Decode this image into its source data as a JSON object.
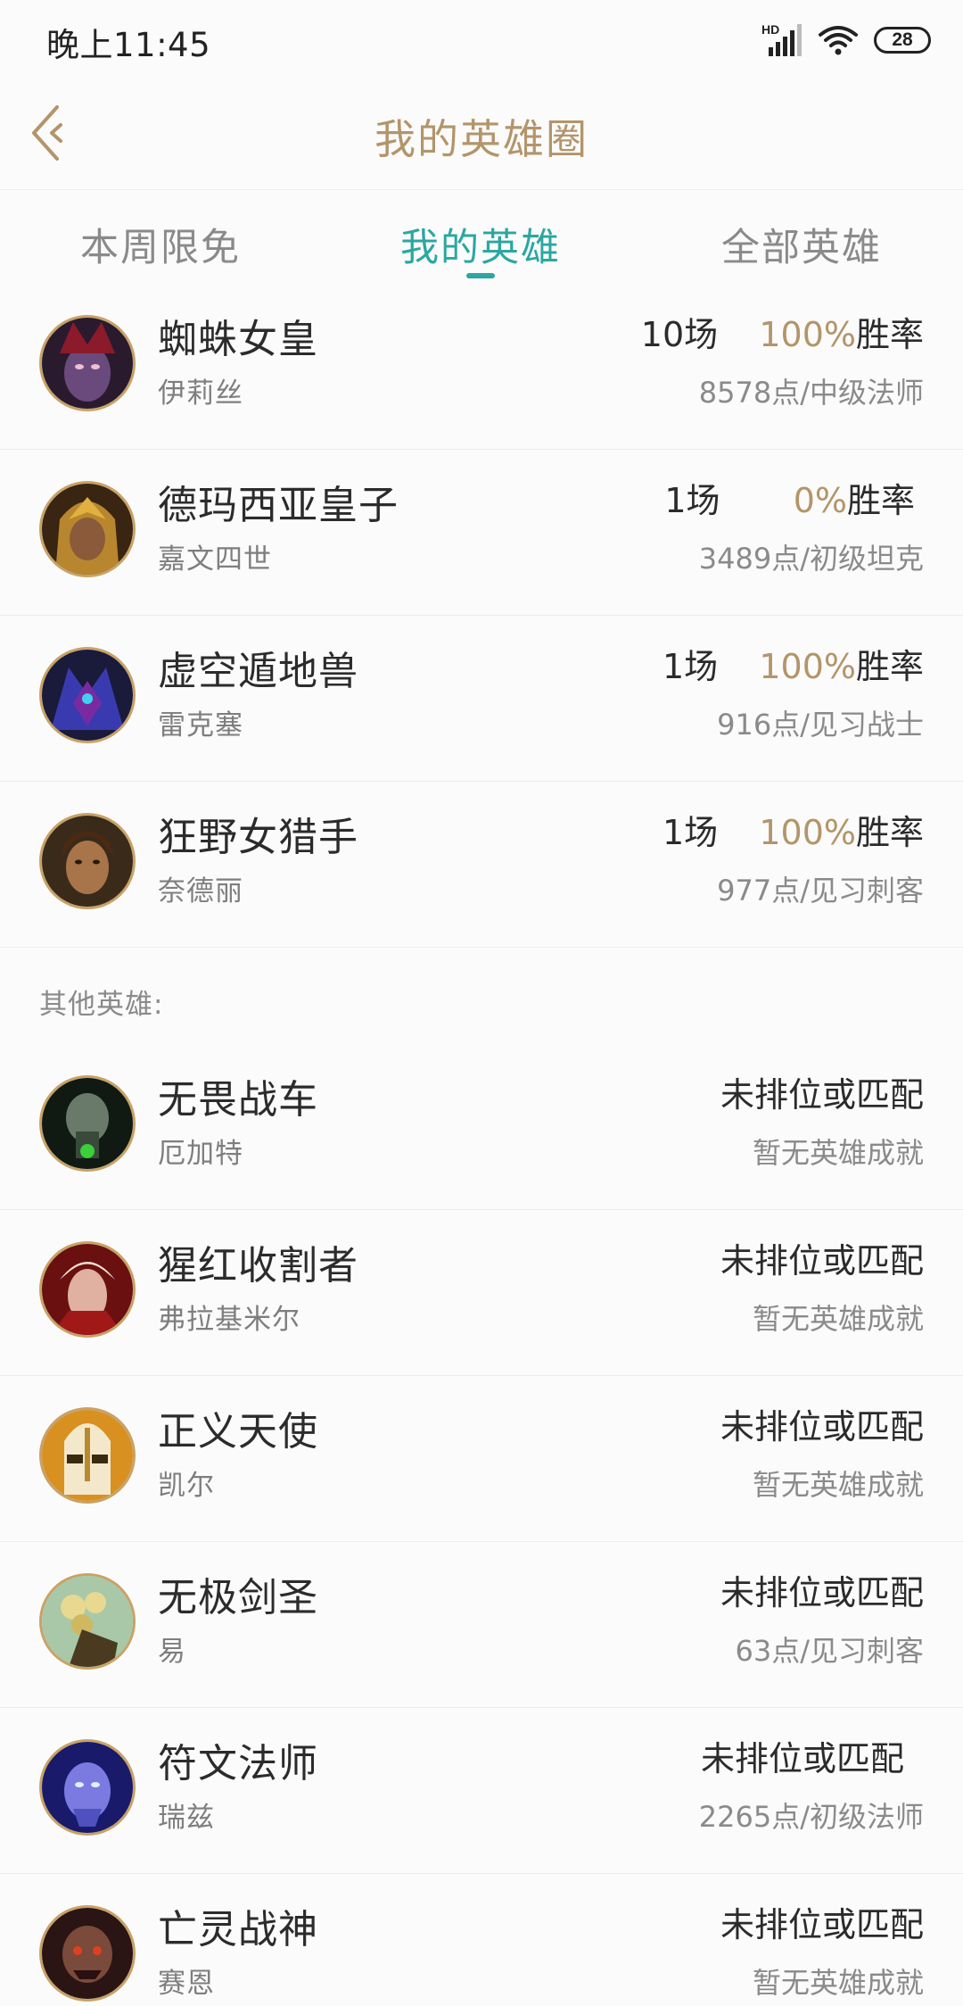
{
  "status_bar": {
    "time": "晚上11:45",
    "signal_label": "HD",
    "battery": "28"
  },
  "header": {
    "title": "我的英雄圈",
    "back_icon": "chevron-left-icon"
  },
  "tabs": [
    {
      "label": "本周限免",
      "active": false
    },
    {
      "label": "我的英雄",
      "active": true
    },
    {
      "label": "全部英雄",
      "active": false
    }
  ],
  "colors": {
    "accent_gold": "#b3956a",
    "accent_teal": "#2aa7a0",
    "avatar_ring": "#c8a266"
  },
  "my_heroes": [
    {
      "name": "蜘蛛女皇",
      "title": "伊莉丝",
      "games": "10场",
      "win_rate": "100%",
      "rate_suffix": "胜率",
      "points": "8578点/中级法师"
    },
    {
      "name": "德玛西亚皇子",
      "title": "嘉文四世",
      "games": "1场",
      "win_rate": "0%",
      "rate_suffix": "胜率",
      "points": "3489点/初级坦克"
    },
    {
      "name": "虚空遁地兽",
      "title": "雷克塞",
      "games": "1场",
      "win_rate": "100%",
      "rate_suffix": "胜率",
      "points": "916点/见习战士"
    },
    {
      "name": "狂野女猎手",
      "title": "奈德丽",
      "games": "1场",
      "win_rate": "100%",
      "rate_suffix": "胜率",
      "points": "977点/见习刺客"
    }
  ],
  "other_heroes_label": "其他英雄:",
  "other_heroes": [
    {
      "name": "无畏战车",
      "title": "厄加特",
      "status": "未排位或匹配",
      "points": "暂无英雄成就"
    },
    {
      "name": "猩红收割者",
      "title": "弗拉基米尔",
      "status": "未排位或匹配",
      "points": "暂无英雄成就"
    },
    {
      "name": "正义天使",
      "title": "凯尔",
      "status": "未排位或匹配",
      "points": "暂无英雄成就"
    },
    {
      "name": "无极剑圣",
      "title": "易",
      "status": "未排位或匹配",
      "points": "63点/见习刺客"
    },
    {
      "name": "符文法师",
      "title": "瑞兹",
      "status": "未排位或匹配",
      "points": "2265点/初级法师"
    },
    {
      "name": "亡灵战神",
      "title": "赛恩",
      "status": "未排位或匹配",
      "points": "暂无英雄成就"
    }
  ]
}
